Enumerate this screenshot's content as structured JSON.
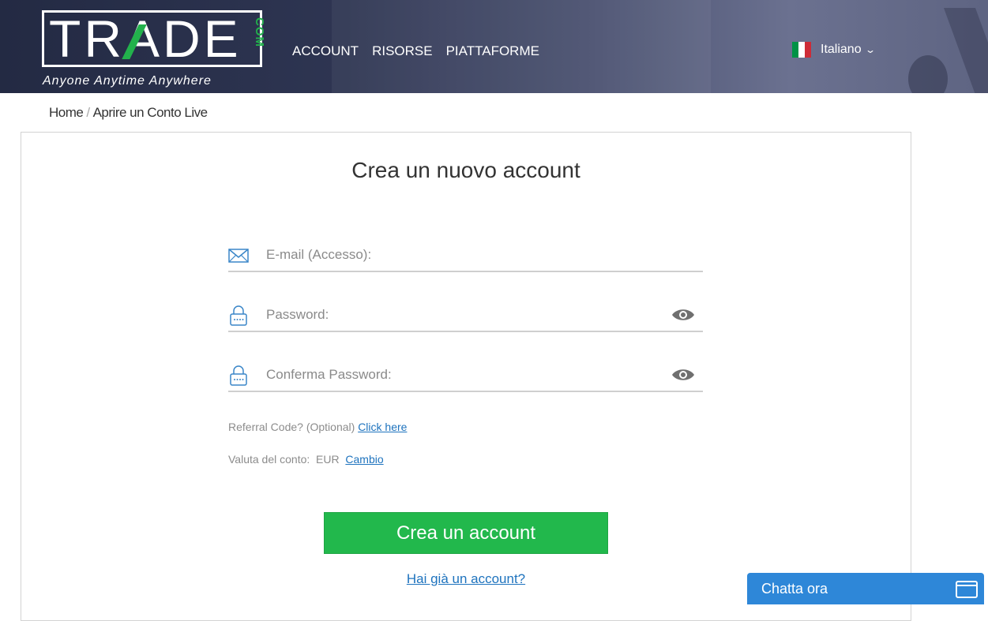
{
  "header": {
    "logo_text": "TRADE",
    "logo_suffix": "COM",
    "tagline": "Anyone Anytime Anywhere",
    "nav": [
      {
        "label": "ACCOUNT"
      },
      {
        "label": "RISORSE"
      },
      {
        "label": "PIATTAFORME"
      }
    ],
    "language": {
      "label": "Italiano",
      "flag_colors": [
        "#009246",
        "#ffffff",
        "#ce2b37"
      ]
    }
  },
  "breadcrumb": {
    "home": "Home",
    "separator": "/",
    "current": "Aprire un Conto Live"
  },
  "form": {
    "title": "Crea un nuovo account",
    "email_placeholder": "E-mail (Accesso):",
    "password_placeholder": "Password:",
    "confirm_placeholder": "Conferma Password:",
    "referral_text": "Referral Code? (Optional)",
    "referral_link": "Click here",
    "currency_label": "Valuta del conto:",
    "currency_value": "EUR",
    "currency_link": "Cambio",
    "submit": "Crea un account",
    "login_link": "Hai già un account?"
  },
  "chat": {
    "label": "Chatta ora"
  },
  "colors": {
    "accent_green": "#22b84c",
    "link_blue": "#1e73be",
    "chat_blue": "#2e87d8",
    "icon_blue": "#3a86c8"
  }
}
